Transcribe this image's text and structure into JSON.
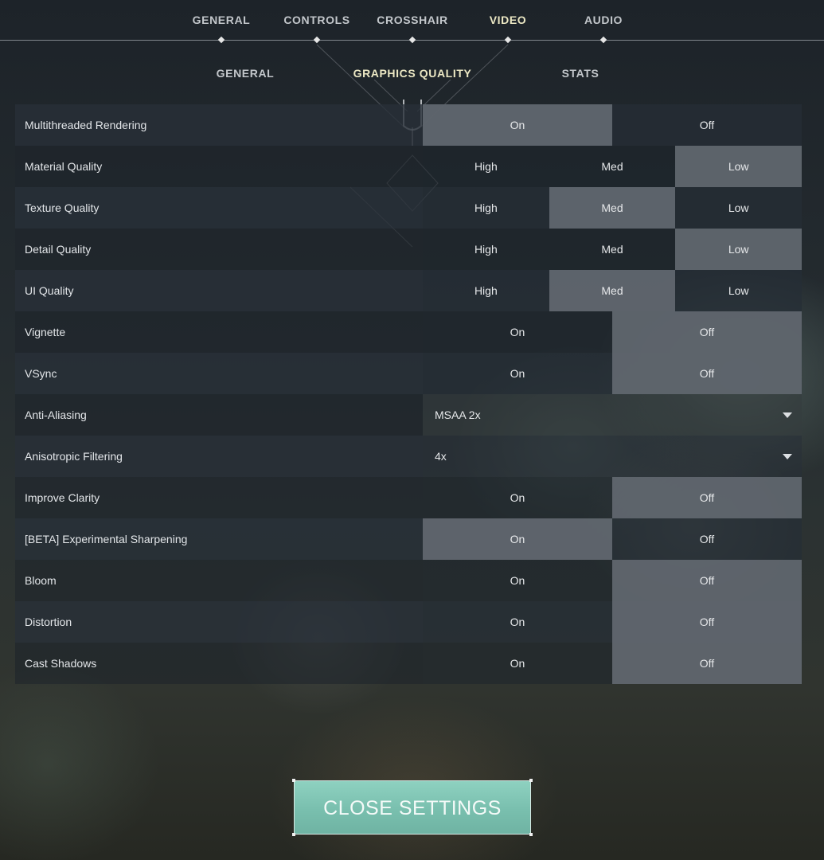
{
  "top_nav": {
    "tabs": [
      {
        "label": "GENERAL"
      },
      {
        "label": "CONTROLS"
      },
      {
        "label": "CROSSHAIR"
      },
      {
        "label": "VIDEO",
        "active": true
      },
      {
        "label": "AUDIO"
      }
    ]
  },
  "sub_nav": {
    "tabs": [
      {
        "label": "GENERAL"
      },
      {
        "label": "GRAPHICS QUALITY",
        "active": true
      },
      {
        "label": "STATS"
      }
    ]
  },
  "settings": [
    {
      "label": "Multithreaded Rendering",
      "type": "toggle",
      "options": [
        "On",
        "Off"
      ],
      "selected": "On"
    },
    {
      "label": "Material Quality",
      "type": "toggle",
      "options": [
        "High",
        "Med",
        "Low"
      ],
      "selected": "Low"
    },
    {
      "label": "Texture Quality",
      "type": "toggle",
      "options": [
        "High",
        "Med",
        "Low"
      ],
      "selected": "Med"
    },
    {
      "label": "Detail Quality",
      "type": "toggle",
      "options": [
        "High",
        "Med",
        "Low"
      ],
      "selected": "Low"
    },
    {
      "label": "UI Quality",
      "type": "toggle",
      "options": [
        "High",
        "Med",
        "Low"
      ],
      "selected": "Med"
    },
    {
      "label": "Vignette",
      "type": "toggle",
      "options": [
        "On",
        "Off"
      ],
      "selected": "Off"
    },
    {
      "label": "VSync",
      "type": "toggle",
      "options": [
        "On",
        "Off"
      ],
      "selected": "Off"
    },
    {
      "label": "Anti-Aliasing",
      "type": "dropdown",
      "value": "MSAA 2x"
    },
    {
      "label": "Anisotropic Filtering",
      "type": "dropdown",
      "value": "4x"
    },
    {
      "label": "Improve Clarity",
      "type": "toggle",
      "options": [
        "On",
        "Off"
      ],
      "selected": "Off"
    },
    {
      "label": "[BETA] Experimental Sharpening",
      "type": "toggle",
      "options": [
        "On",
        "Off"
      ],
      "selected": "On"
    },
    {
      "label": "Bloom",
      "type": "toggle",
      "options": [
        "On",
        "Off"
      ],
      "selected": "Off"
    },
    {
      "label": "Distortion",
      "type": "toggle",
      "options": [
        "On",
        "Off"
      ],
      "selected": "Off"
    },
    {
      "label": "Cast Shadows",
      "type": "toggle",
      "options": [
        "On",
        "Off"
      ],
      "selected": "Off"
    }
  ],
  "close_button": {
    "label": "CLOSE SETTINGS"
  },
  "colors": {
    "accent_active": "#ece8c4",
    "close_button": "#7fc4b3",
    "selected_option": "#62686f"
  },
  "icons": {
    "dropdown": "caret-down-icon",
    "nav_marker": "diamond-icon"
  }
}
